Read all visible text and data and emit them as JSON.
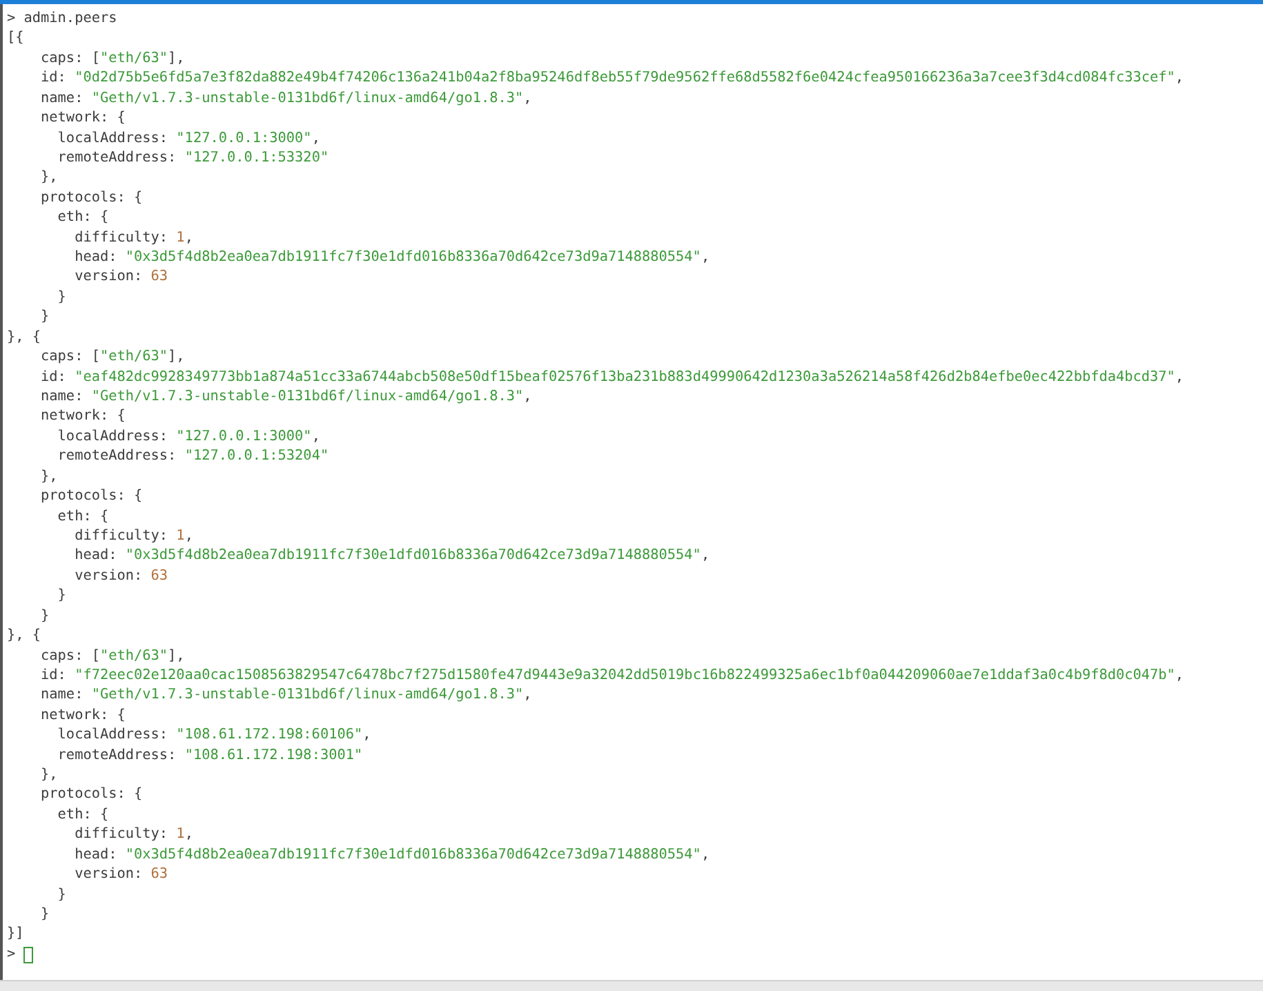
{
  "console": {
    "lines": [
      [
        {
          "kind": "plain",
          "text": "> admin.peers"
        }
      ],
      [
        {
          "kind": "plain",
          "text": "[{"
        }
      ],
      [
        {
          "kind": "plain",
          "text": "    caps: ["
        },
        {
          "kind": "string",
          "text": "\"eth/63\""
        },
        {
          "kind": "plain",
          "text": "],"
        }
      ],
      [
        {
          "kind": "plain",
          "text": "    id: "
        },
        {
          "kind": "string",
          "text": "\"0d2d75b5e6fd5a7e3f82da882e49b4f74206c136a241b04a2f8ba95246df8eb55f79de9562ffe68d5582f6e0424cfea950166236a3a7cee3f3d4cd084fc33cef\""
        },
        {
          "kind": "plain",
          "text": ","
        }
      ],
      [
        {
          "kind": "plain",
          "text": "    name: "
        },
        {
          "kind": "string",
          "text": "\"Geth/v1.7.3-unstable-0131bd6f/linux-amd64/go1.8.3\""
        },
        {
          "kind": "plain",
          "text": ","
        }
      ],
      [
        {
          "kind": "plain",
          "text": "    network: {"
        }
      ],
      [
        {
          "kind": "plain",
          "text": "      localAddress: "
        },
        {
          "kind": "string",
          "text": "\"127.0.0.1:3000\""
        },
        {
          "kind": "plain",
          "text": ","
        }
      ],
      [
        {
          "kind": "plain",
          "text": "      remoteAddress: "
        },
        {
          "kind": "string",
          "text": "\"127.0.0.1:53320\""
        }
      ],
      [
        {
          "kind": "plain",
          "text": "    },"
        }
      ],
      [
        {
          "kind": "plain",
          "text": "    protocols: {"
        }
      ],
      [
        {
          "kind": "plain",
          "text": "      eth: {"
        }
      ],
      [
        {
          "kind": "plain",
          "text": "        difficulty: "
        },
        {
          "kind": "number",
          "text": "1"
        },
        {
          "kind": "plain",
          "text": ","
        }
      ],
      [
        {
          "kind": "plain",
          "text": "        head: "
        },
        {
          "kind": "string",
          "text": "\"0x3d5f4d8b2ea0ea7db1911fc7f30e1dfd016b8336a70d642ce73d9a7148880554\""
        },
        {
          "kind": "plain",
          "text": ","
        }
      ],
      [
        {
          "kind": "plain",
          "text": "        version: "
        },
        {
          "kind": "number",
          "text": "63"
        }
      ],
      [
        {
          "kind": "plain",
          "text": "      }"
        }
      ],
      [
        {
          "kind": "plain",
          "text": "    }"
        }
      ],
      [
        {
          "kind": "plain",
          "text": "}, {"
        }
      ],
      [
        {
          "kind": "plain",
          "text": "    caps: ["
        },
        {
          "kind": "string",
          "text": "\"eth/63\""
        },
        {
          "kind": "plain",
          "text": "],"
        }
      ],
      [
        {
          "kind": "plain",
          "text": "    id: "
        },
        {
          "kind": "string",
          "text": "\"eaf482dc9928349773bb1a874a51cc33a6744abcb508e50df15beaf02576f13ba231b883d49990642d1230a3a526214a58f426d2b84efbe0ec422bbfda4bcd37\""
        },
        {
          "kind": "plain",
          "text": ","
        }
      ],
      [
        {
          "kind": "plain",
          "text": "    name: "
        },
        {
          "kind": "string",
          "text": "\"Geth/v1.7.3-unstable-0131bd6f/linux-amd64/go1.8.3\""
        },
        {
          "kind": "plain",
          "text": ","
        }
      ],
      [
        {
          "kind": "plain",
          "text": "    network: {"
        }
      ],
      [
        {
          "kind": "plain",
          "text": "      localAddress: "
        },
        {
          "kind": "string",
          "text": "\"127.0.0.1:3000\""
        },
        {
          "kind": "plain",
          "text": ","
        }
      ],
      [
        {
          "kind": "plain",
          "text": "      remoteAddress: "
        },
        {
          "kind": "string",
          "text": "\"127.0.0.1:53204\""
        }
      ],
      [
        {
          "kind": "plain",
          "text": "    },"
        }
      ],
      [
        {
          "kind": "plain",
          "text": "    protocols: {"
        }
      ],
      [
        {
          "kind": "plain",
          "text": "      eth: {"
        }
      ],
      [
        {
          "kind": "plain",
          "text": "        difficulty: "
        },
        {
          "kind": "number",
          "text": "1"
        },
        {
          "kind": "plain",
          "text": ","
        }
      ],
      [
        {
          "kind": "plain",
          "text": "        head: "
        },
        {
          "kind": "string",
          "text": "\"0x3d5f4d8b2ea0ea7db1911fc7f30e1dfd016b8336a70d642ce73d9a7148880554\""
        },
        {
          "kind": "plain",
          "text": ","
        }
      ],
      [
        {
          "kind": "plain",
          "text": "        version: "
        },
        {
          "kind": "number",
          "text": "63"
        }
      ],
      [
        {
          "kind": "plain",
          "text": "      }"
        }
      ],
      [
        {
          "kind": "plain",
          "text": "    }"
        }
      ],
      [
        {
          "kind": "plain",
          "text": "}, {"
        }
      ],
      [
        {
          "kind": "plain",
          "text": "    caps: ["
        },
        {
          "kind": "string",
          "text": "\"eth/63\""
        },
        {
          "kind": "plain",
          "text": "],"
        }
      ],
      [
        {
          "kind": "plain",
          "text": "    id: "
        },
        {
          "kind": "string",
          "text": "\"f72eec02e120aa0cac1508563829547c6478bc7f275d1580fe47d9443e9a32042dd5019bc16b822499325a6ec1bf0a044209060ae7e1ddaf3a0c4b9f8d0c047b\""
        },
        {
          "kind": "plain",
          "text": ","
        }
      ],
      [
        {
          "kind": "plain",
          "text": "    name: "
        },
        {
          "kind": "string",
          "text": "\"Geth/v1.7.3-unstable-0131bd6f/linux-amd64/go1.8.3\""
        },
        {
          "kind": "plain",
          "text": ","
        }
      ],
      [
        {
          "kind": "plain",
          "text": "    network: {"
        }
      ],
      [
        {
          "kind": "plain",
          "text": "      localAddress: "
        },
        {
          "kind": "string",
          "text": "\"108.61.172.198:60106\""
        },
        {
          "kind": "plain",
          "text": ","
        }
      ],
      [
        {
          "kind": "plain",
          "text": "      remoteAddress: "
        },
        {
          "kind": "string",
          "text": "\"108.61.172.198:3001\""
        }
      ],
      [
        {
          "kind": "plain",
          "text": "    },"
        }
      ],
      [
        {
          "kind": "plain",
          "text": "    protocols: {"
        }
      ],
      [
        {
          "kind": "plain",
          "text": "      eth: {"
        }
      ],
      [
        {
          "kind": "plain",
          "text": "        difficulty: "
        },
        {
          "kind": "number",
          "text": "1"
        },
        {
          "kind": "plain",
          "text": ","
        }
      ],
      [
        {
          "kind": "plain",
          "text": "        head: "
        },
        {
          "kind": "string",
          "text": "\"0x3d5f4d8b2ea0ea7db1911fc7f30e1dfd016b8336a70d642ce73d9a7148880554\""
        },
        {
          "kind": "plain",
          "text": ","
        }
      ],
      [
        {
          "kind": "plain",
          "text": "        version: "
        },
        {
          "kind": "number",
          "text": "63"
        }
      ],
      [
        {
          "kind": "plain",
          "text": "      }"
        }
      ],
      [
        {
          "kind": "plain",
          "text": "    }"
        }
      ],
      [
        {
          "kind": "plain",
          "text": "}]"
        }
      ]
    ],
    "prompt": {
      "symbol": ">",
      "cursor": true
    }
  }
}
